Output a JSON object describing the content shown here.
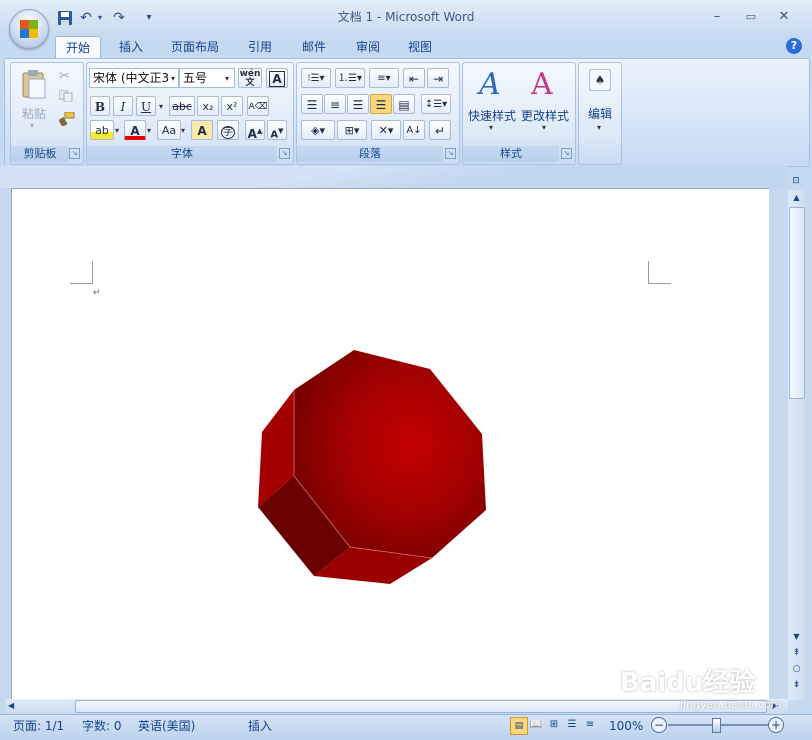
{
  "window": {
    "title": "文档 1 - Microsoft Word"
  },
  "quick_access": {
    "save": "save-icon",
    "undo": "↶",
    "redo": "↷",
    "customize": "▾"
  },
  "tabs": [
    {
      "label": "开始",
      "active": true
    },
    {
      "label": "插入"
    },
    {
      "label": "页面布局"
    },
    {
      "label": "引用"
    },
    {
      "label": "邮件"
    },
    {
      "label": "审阅"
    },
    {
      "label": "视图"
    }
  ],
  "ribbon": {
    "clipboard": {
      "paste_label": "粘贴",
      "group_label": "剪贴板"
    },
    "font": {
      "font_name": "宋体 (中文正3",
      "font_size": "五号",
      "wen": "wén\n文",
      "group_label": "字体",
      "bold": "B",
      "italic": "I",
      "underline": "U",
      "strike": "abc",
      "sub": "x₂",
      "sup": "x²",
      "highlight": "ab",
      "font_color": "A",
      "case": "Aa",
      "shade": "A",
      "enclose": "字",
      "grow": "A",
      "shrink": "A"
    },
    "paragraph": {
      "group_label": "段落"
    },
    "styles": {
      "quick_styles": "快速样式",
      "change_styles": "更改样式",
      "group_label": "样式"
    },
    "editing": {
      "label": "编辑"
    }
  },
  "status": {
    "page": "页面: 1/1",
    "words": "字数: 0",
    "language": "英语(美国)",
    "mode": "插入",
    "zoom": "100%"
  },
  "watermark": {
    "brand": "Baidu经验",
    "url": "jingyan.baidu.com"
  },
  "colors": {
    "accent": "#15428b",
    "shape": "#c00000",
    "shape_dark": "#6e0000"
  }
}
